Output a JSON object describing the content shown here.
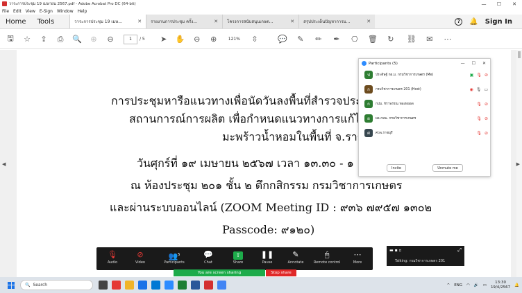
{
  "window": {
    "title": "วาระการประชุม 19 เมษายน 2567.pdf - Adobe Acrobat Pro DC (64-bit)",
    "controls": [
      "—",
      "☐",
      "✕"
    ]
  },
  "menu": [
    "File",
    "Edit",
    "View",
    "E-Sign",
    "Window",
    "Help"
  ],
  "tabbar": {
    "home": "Home",
    "tools": "Tools",
    "tabs": [
      {
        "label": "วาระการประชุม 19 เมษ..."
      },
      {
        "label": "รายงานการประชุม ครั้ง..."
      },
      {
        "label": "โครงการสนับสนุนเกษต..."
      },
      {
        "label": "สรุปประเด็นปัญหาการม..."
      }
    ],
    "close_glyph": "✕",
    "help": "?",
    "signin": "Sign In"
  },
  "toolbar": {
    "page_current": "1",
    "page_total": "/ 5",
    "zoom": "121%"
  },
  "document": {
    "lines": [
      "การประชุมหารือแนวทางเพื่อนัดวันลงพื้นที่สำรวจประเมิน",
      "สถานการณ์การผลิต เพื่อกำหนดแนวทางการแก้ไขปัญหา",
      "มะพร้าวน้ำหอมในพื้นที่ จ.ราชบุรี",
      "วันศุกร์ที่ ๑๙ เมษายน ๒๕๖๗ เวลา ๑๓.๓๐ - ๑",
      "ณ ห้องประชุม ๒๐๑ ชั้น ๒ ตึกกสิกรรม กรมวิชาการเกษตร",
      "และผ่านระบบออนไลน์ (ZOOM Meeting ID : ๙๓๖ ๗๙๕๗ ๑๓๐๒",
      "Passcode: ๙๑๒๐)"
    ]
  },
  "participants": {
    "title": "Participants (5)",
    "list": [
      {
        "initial": "ป",
        "name": "ประดิษฐ์ กผ.ม. กรมวิชาการเกษตร (Me)",
        "color": "#2e7d32"
      },
      {
        "initial": "ก",
        "name": "กรมวิชาการเกษตร 201 (Host)",
        "color": "#6d4c1f"
      },
      {
        "initial": "ก",
        "name": "กปม. จิราพรรณ ทองหยอด",
        "color": "#2e7d32"
      },
      {
        "initial": "ผ",
        "name": "ผอ.กมพ. กรมวิชาการเกษตร",
        "color": "#2e7d32"
      },
      {
        "initial": "ศ",
        "name": "ศวพ.ราชบุรี",
        "color": "#37474f"
      }
    ],
    "invite": "Invite",
    "unmute": "Unmute me"
  },
  "zoom_bar": {
    "items": [
      {
        "label": "Audio",
        "icon": "mic-muted-icon"
      },
      {
        "label": "Video",
        "icon": "video-off-icon"
      },
      {
        "label": "Participants",
        "icon": "participants-icon",
        "badge": "5"
      },
      {
        "label": "Chat",
        "icon": "chat-icon"
      },
      {
        "label": "Share",
        "icon": "share-icon"
      },
      {
        "label": "Pause",
        "icon": "pause-icon"
      },
      {
        "label": "Annotate",
        "icon": "annotate-icon"
      },
      {
        "label": "Remote control",
        "icon": "remote-control-icon"
      },
      {
        "label": "More",
        "icon": "more-icon"
      }
    ],
    "sharing": "You are screen sharing",
    "stop_share": "Stop share",
    "talking": "Talking: กรมวิชาการเกษตร 201"
  },
  "taskbar": {
    "search": "Search",
    "lang": "ENG",
    "time": "13:30",
    "date": "19/4/2567"
  }
}
